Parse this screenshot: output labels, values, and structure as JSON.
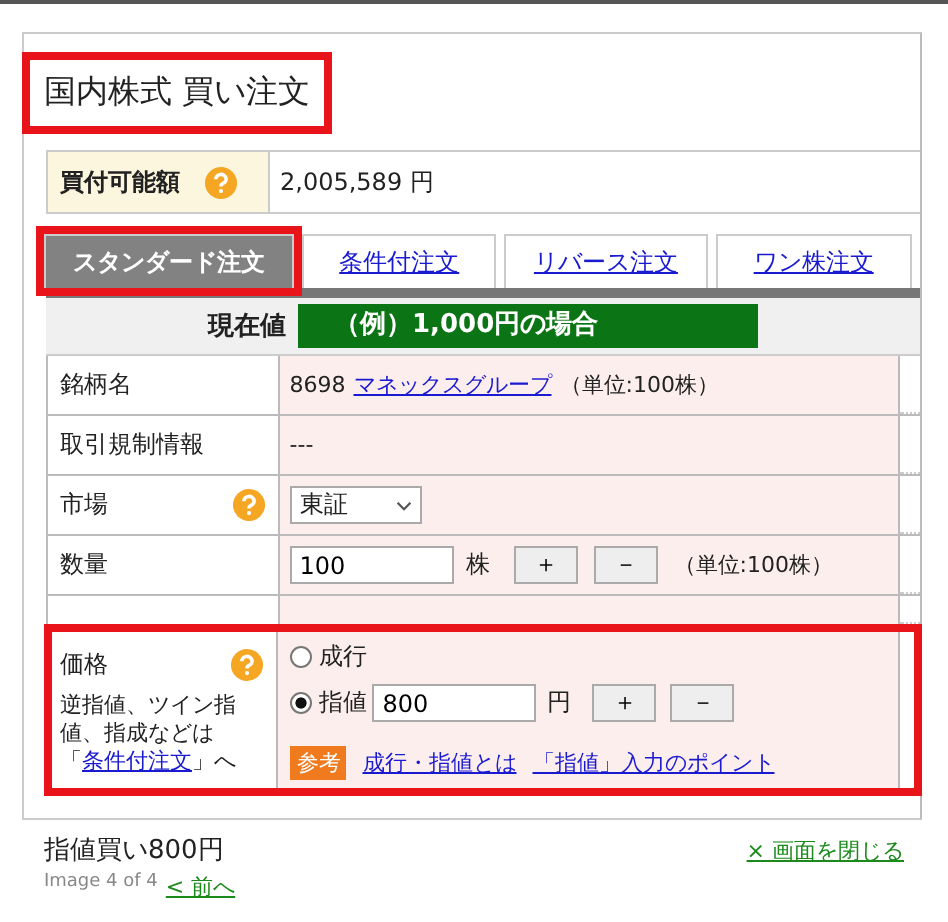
{
  "title": {
    "text": "国内株式  買い注文",
    "highlighted": true
  },
  "buying_power": {
    "label": "買付可能額",
    "help": true,
    "value": "2,005,589 円"
  },
  "tabs": [
    {
      "label": "スタンダード注文",
      "selected": true,
      "highlighted": true
    },
    {
      "label": "条件付注文",
      "selected": false,
      "highlighted": false
    },
    {
      "label": "リバース注文",
      "selected": false,
      "highlighted": false
    },
    {
      "label": "ワン株注文",
      "selected": false,
      "highlighted": false
    }
  ],
  "current_price": {
    "label": "現在値",
    "value": "（例）1,000円の場合"
  },
  "rows": [
    {
      "kind": "stock",
      "label": "銘柄名",
      "help": false,
      "code": "8698",
      "link": "マネックスグループ",
      "note": "（単位:100株）"
    },
    {
      "kind": "text",
      "label": "取引規制情報",
      "help": false,
      "value": "---"
    },
    {
      "kind": "select",
      "label": "市場",
      "help": true,
      "value": "東証"
    },
    {
      "kind": "quantity",
      "label": "数量",
      "help": false,
      "value": "100",
      "unit": "株",
      "buttons": [
        "＋",
        "－"
      ],
      "note": "（単位:100株）"
    },
    {
      "kind": "blank"
    },
    {
      "kind": "price",
      "label": "価格",
      "help": true,
      "highlighted": true,
      "hint_before": "逆指値、ツイン指値、指成などは「",
      "hint_link": "条件付注文",
      "hint_after": "」へ",
      "options": [
        {
          "label": "成行",
          "selected": false
        },
        {
          "label": "指値",
          "selected": true,
          "value": "800",
          "unit": "円",
          "buttons": [
            "＋",
            "－"
          ]
        }
      ],
      "tag": "参考",
      "links": [
        "成行・指値とは",
        "「指値」入力のポイント"
      ]
    }
  ],
  "footer": {
    "caption": "指値買い800円",
    "close_link": "× 画面を閉じる",
    "pager": "Image 4 of 4",
    "prev_link": "< 前へ"
  }
}
